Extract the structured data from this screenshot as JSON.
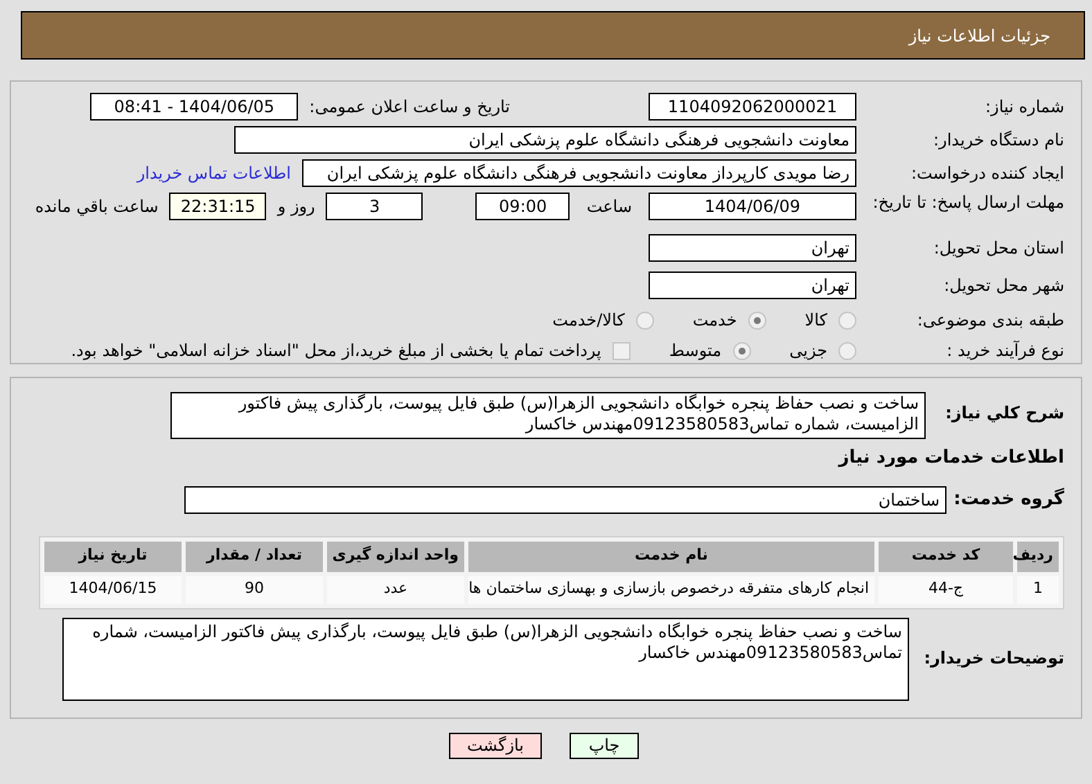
{
  "header": {
    "title": "جزئیات اطلاعات نیاز"
  },
  "need_number": {
    "label": "شماره نیاز:",
    "value": "1104092062000021"
  },
  "announce": {
    "label": "تاریخ و ساعت اعلان عمومی:",
    "value": "1404/06/05 - 08:41"
  },
  "buyer": {
    "label": "نام دستگاه خریدار:",
    "value": "معاونت دانشجویی  فرهنگی دانشگاه علوم پزشکی ایران"
  },
  "creator": {
    "label": "ایجاد کننده درخواست:",
    "value": "رضا  مویدی  کارپرداز معاونت دانشجویی  فرهنگی دانشگاه علوم پزشکی ایران",
    "link": "اطلاعات تماس خریدار"
  },
  "deadline": {
    "label": "مهلت ارسال پاسخ: تا تاریخ:",
    "date": "1404/06/09",
    "time_label": "ساعت",
    "time": "09:00",
    "days": "3",
    "days_label": "روز و",
    "remaining": "22:31:15",
    "remaining_label": "ساعت باقي مانده"
  },
  "province": {
    "label": "استان محل تحویل:",
    "value": "تهران"
  },
  "city": {
    "label": "شهر محل تحویل:",
    "value": "تهران"
  },
  "category": {
    "label": "طبقه بندی موضوعی:",
    "options": [
      {
        "label": "کالا",
        "selected": false
      },
      {
        "label": "خدمت",
        "selected": true
      },
      {
        "label": "کالا/خدمت",
        "selected": false
      }
    ]
  },
  "process": {
    "label": "نوع فرآیند خرید :",
    "options": [
      {
        "label": "جزیی",
        "selected": false
      },
      {
        "label": "متوسط",
        "selected": true
      }
    ],
    "treasury": {
      "label": "پرداخت تمام یا بخشی از مبلغ خرید،از محل \"اسناد خزانه اسلامی\" خواهد بود.",
      "checked": false
    }
  },
  "summary": {
    "label": "شرح کلي نیاز:",
    "value": "ساخت و نصب حفاظ پنجره  خوابگاه دانشجویی الزهرا(س) طبق فایل پیوست، بارگذاری پیش فاکتور الزامیست، شماره تماس09123580583مهندس خاکسار"
  },
  "services_heading": "اطلاعات خدمات مورد نیاز",
  "service_group": {
    "label": "گروه خدمت:",
    "value": "ساختمان"
  },
  "table": {
    "columns": [
      "ردیف",
      "کد خدمت",
      "نام خدمت",
      "واحد اندازه گیری",
      "تعداد / مقدار",
      "تاریخ نیاز"
    ],
    "rows": [
      [
        "1",
        "ج-44",
        "انجام کارهای متفرقه درخصوص بازسازی و بهسازی ساختمان ها",
        "عدد",
        "90",
        "1404/06/15"
      ]
    ]
  },
  "buyer_notes": {
    "label": "توضیحات خریدار:",
    "value": "ساخت و نصب حفاظ پنجره  خوابگاه دانشجویی الزهرا(س) طبق فایل پیوست، بارگذاری پیش فاکتور الزامیست، شماره تماس09123580583مهندس خاکسار"
  },
  "buttons": [
    {
      "label": "چاپ",
      "kind": "print"
    },
    {
      "label": "بازگشت",
      "kind": "back"
    }
  ]
}
